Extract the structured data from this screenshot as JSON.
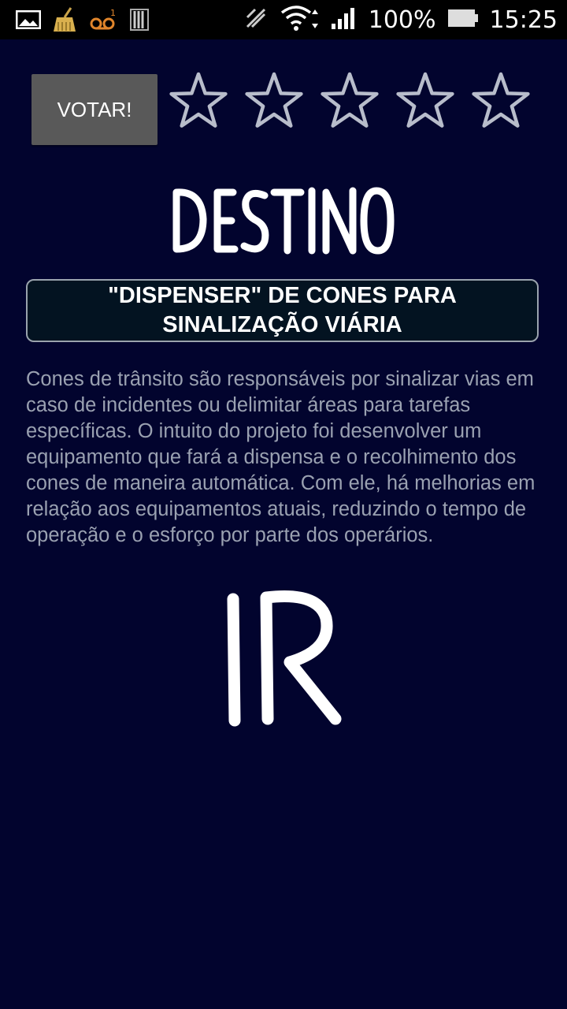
{
  "status_bar": {
    "battery": "100%",
    "time": "15:25",
    "icons": [
      "gallery-icon",
      "cleaner-icon",
      "voicemail-icon",
      "sim-icon",
      "signal-off-icon",
      "wifi-icon",
      "cell-signal-icon",
      "battery-icon"
    ]
  },
  "vote": {
    "button_label": "VOTAR!",
    "rating": 0,
    "max_rating": 5
  },
  "header": {
    "logo_text": "DESTINO"
  },
  "project": {
    "title": "\"DISPENSER\" DE CONES PARA SINALIZAÇÃO VIÁRIA",
    "description": "Cones de trânsito são responsáveis por sinalizar vias em caso de incidentes ou delimitar áreas para tarefas específicas. O intuito do projeto foi desenvolver um equipamento que fará a dispensa e o recolhimento dos cones de maneira automática. Com ele, há melhorias em relação aos equipamentos atuais, reduzindo o tempo de operação e o esforço por parte dos operários."
  },
  "action": {
    "go_text": "IR"
  },
  "colors": {
    "background": "#02042e",
    "title_box_bg": "#031321",
    "title_box_border": "#9aa3ad",
    "description_text": "#9aa1b1",
    "star_outline": "#b8bdcb",
    "button_bg": "#595959"
  }
}
